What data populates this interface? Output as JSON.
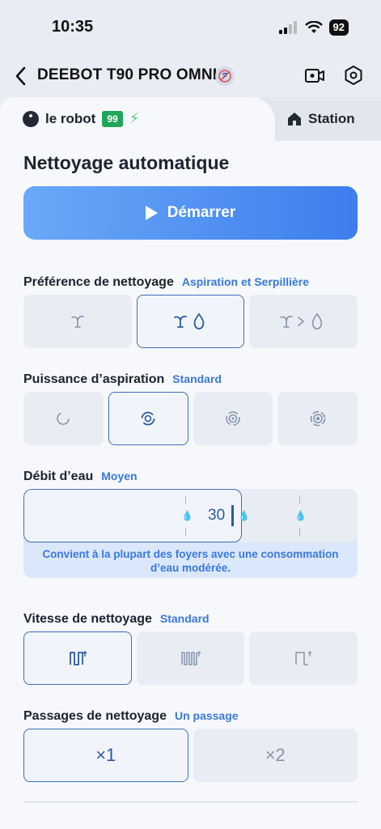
{
  "status_bar": {
    "time": "10:35",
    "battery": "92"
  },
  "nav": {
    "title": "DEEBOT T90 PRO OMNI"
  },
  "tabs": {
    "robot_label": "le robot",
    "robot_battery": "99",
    "station_label": "Station"
  },
  "main": {
    "heading": "Nettoyage automatique",
    "start_label": "Démarrer"
  },
  "preference": {
    "label": "Préférence de nettoyage",
    "value": "Aspiration et Serpillière",
    "options": [
      "vacuum-icon",
      "vacuum-mop-icon",
      "vacuum-then-mop-icon"
    ],
    "selected_index": 1
  },
  "suction": {
    "label": "Puissance d’aspiration",
    "value": "Standard",
    "options": [
      "quiet-icon",
      "standard-icon",
      "max-icon",
      "max-plus-icon"
    ],
    "selected_index": 1
  },
  "water": {
    "label": "Débit d’eau",
    "value": "Moyen",
    "level": "30",
    "hint": "Convient à la plupart des foyers avec une consommation d’eau modérée."
  },
  "speed": {
    "label": "Vitesse de nettoyage",
    "value": "Standard",
    "options": [
      "standard-route-icon",
      "deep-route-icon",
      "quick-route-icon"
    ],
    "selected_index": 0
  },
  "passes": {
    "label": "Passages de nettoyage",
    "value": "Un passage",
    "options": [
      "×1",
      "×2"
    ],
    "selected_index": 0
  }
}
